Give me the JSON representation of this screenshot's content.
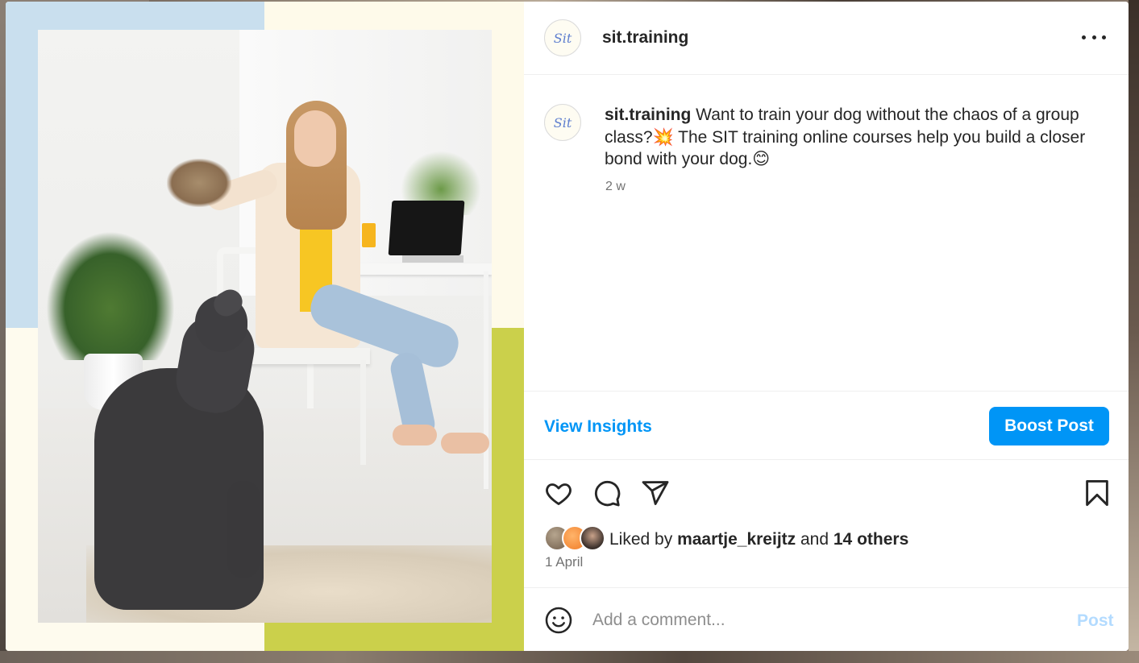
{
  "post": {
    "username": "sit.training",
    "avatar_text": "Sit",
    "caption_username": "sit.training",
    "caption_text": " Want to train your dog without the chaos of a group class?💥  The SIT training online courses help you build a closer bond with your dog.😊",
    "age": "2 w"
  },
  "insights": {
    "view_label": "View Insights",
    "boost_label": "Boost Post"
  },
  "likes": {
    "prefix": "Liked by ",
    "user": "maartje_kreijtz",
    "and": " and ",
    "others": "14 others"
  },
  "date": "1 April",
  "comment": {
    "placeholder": "Add a comment...",
    "post_label": "Post"
  },
  "icons": {
    "more": "more-options-icon",
    "like": "heart-icon",
    "comment": "comment-icon",
    "share": "paper-plane-icon",
    "save": "bookmark-icon",
    "emoji": "smiley-icon"
  },
  "colors": {
    "accent": "#0095f6",
    "post_disabled": "#b3dbff",
    "text": "#262626",
    "muted": "#737373"
  }
}
